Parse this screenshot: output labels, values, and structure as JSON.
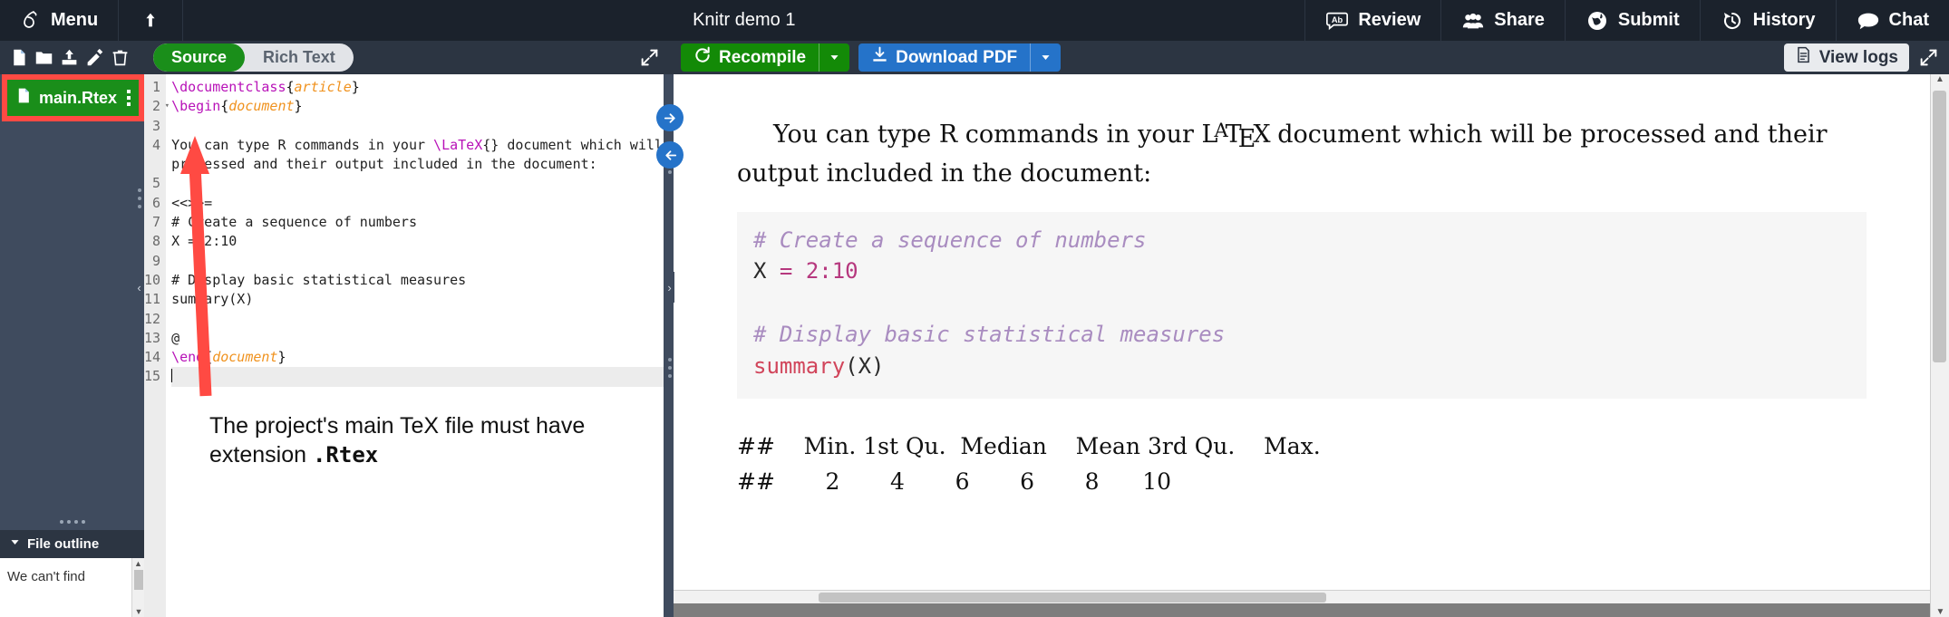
{
  "topnav": {
    "menu_label": "Menu",
    "upload_icon": "upload-arrow-icon",
    "project_title": "Knitr demo 1",
    "right_items": [
      {
        "label": "Review",
        "icon": "review-ab-icon"
      },
      {
        "label": "Share",
        "icon": "people-icon"
      },
      {
        "label": "Submit",
        "icon": "globe-icon"
      },
      {
        "label": "History",
        "icon": "history-clock-icon"
      },
      {
        "label": "Chat",
        "icon": "chat-bubble-icon"
      }
    ]
  },
  "file_panel": {
    "toolbar_icons": [
      "new-file-icon",
      "new-folder-icon",
      "upload-icon",
      "rename-pencil-icon",
      "delete-trash-icon"
    ],
    "files": [
      {
        "name": "main.Rtex",
        "icon": "tex-file-icon",
        "menu_icon": "kebab-menu-icon",
        "selected": true,
        "highlight_color": "#1a8e1a",
        "annotation_border_color": "#ff4a43"
      }
    ],
    "outline_title": "File outline",
    "outline_chevron": "chevron-down-icon",
    "outline_body_text": "We can't find"
  },
  "editor": {
    "tabs": [
      {
        "label": "Source",
        "active": true
      },
      {
        "label": "Rich Text",
        "active": false
      }
    ],
    "expand_icon": "expand-diagonal-icon",
    "lines": [
      {
        "no": "1",
        "fold": false,
        "segments": [
          {
            "t": "\\documentclass",
            "c": "cmd"
          },
          {
            "t": "{",
            "c": "brace"
          },
          {
            "t": "article",
            "c": "arg2"
          },
          {
            "t": "}",
            "c": "brace"
          }
        ]
      },
      {
        "no": "2",
        "fold": true,
        "segments": [
          {
            "t": "\\begin",
            "c": "cmd"
          },
          {
            "t": "{",
            "c": "brace"
          },
          {
            "t": "document",
            "c": "arg"
          },
          {
            "t": "}",
            "c": "brace"
          }
        ]
      },
      {
        "no": "3",
        "fold": false,
        "segments": []
      },
      {
        "no": "4",
        "fold": false,
        "segments": [
          {
            "t": "You can type R commands in your ",
            "c": "plain"
          },
          {
            "t": "\\LaTeX",
            "c": "cmd"
          },
          {
            "t": "{} document which will be",
            "c": "plain"
          }
        ]
      },
      {
        "no": "",
        "fold": false,
        "segments": [
          {
            "t": "processed and their output included in the document:",
            "c": "plain"
          }
        ]
      },
      {
        "no": "5",
        "fold": false,
        "segments": []
      },
      {
        "no": "6",
        "fold": false,
        "segments": [
          {
            "t": "<<>>=",
            "c": "plain"
          }
        ]
      },
      {
        "no": "7",
        "fold": false,
        "segments": [
          {
            "t": "# Create a sequence of numbers",
            "c": "plain"
          }
        ]
      },
      {
        "no": "8",
        "fold": false,
        "segments": [
          {
            "t": "X = 2:10",
            "c": "plain"
          }
        ]
      },
      {
        "no": "9",
        "fold": false,
        "segments": []
      },
      {
        "no": "10",
        "fold": false,
        "segments": [
          {
            "t": "# Display basic statistical measures",
            "c": "plain"
          }
        ]
      },
      {
        "no": "11",
        "fold": false,
        "segments": [
          {
            "t": "summary(X)",
            "c": "plain"
          }
        ]
      },
      {
        "no": "12",
        "fold": false,
        "segments": []
      },
      {
        "no": "13",
        "fold": false,
        "segments": [
          {
            "t": "@",
            "c": "plain"
          }
        ]
      },
      {
        "no": "14",
        "fold": false,
        "segments": [
          {
            "t": "\\end",
            "c": "cmd"
          },
          {
            "t": "{",
            "c": "brace"
          },
          {
            "t": "document",
            "c": "arg"
          },
          {
            "t": "}",
            "c": "brace"
          }
        ]
      },
      {
        "no": "15",
        "fold": false,
        "cursor": true,
        "segments": []
      }
    ],
    "annotation": {
      "text_line1": "The project's main TeX file must have",
      "text_line2_prefix": "extension ",
      "text_line2_mono": ".Rtex",
      "arrow_color": "#ff4a43"
    }
  },
  "pdf": {
    "recompile_label": "Recompile",
    "recompile_icon": "refresh-icon",
    "recompile_caret": "chevron-down-icon",
    "recompile_color": "#138a07",
    "download_label": "Download PDF",
    "download_icon": "download-icon",
    "download_caret": "chevron-down-icon",
    "download_color": "#2573c9",
    "viewlogs_label": "View logs",
    "viewlogs_icon": "logs-file-icon",
    "expand_icon": "expand-diagonal-icon",
    "sync_to_pdf_icon": "arrow-right-circle-icon",
    "sync_to_code_icon": "arrow-left-circle-icon",
    "paragraph": "You can type R commands in your LATEX document which will be processed and their output included in the document:",
    "paragraph_plain": "You can type R commands in your ",
    "paragraph_latex": "LaTeX",
    "paragraph_rest": " document which will be processed and their output included in the document:",
    "code_lines": [
      {
        "tokens": [
          {
            "t": "# Create a sequence of numbers",
            "c": "comment"
          }
        ]
      },
      {
        "tokens": [
          {
            "t": "X ",
            "c": "ident"
          },
          {
            "t": "= ",
            "c": "op"
          },
          {
            "t": "2:10",
            "c": "num"
          }
        ]
      },
      {
        "tokens": [
          {
            "t": "",
            "c": "ident"
          }
        ]
      },
      {
        "tokens": [
          {
            "t": "# Display basic statistical measures",
            "c": "comment"
          }
        ]
      },
      {
        "tokens": [
          {
            "t": "summary",
            "c": "fn"
          },
          {
            "t": "(X)",
            "c": "ident"
          }
        ]
      }
    ],
    "output_header": "##    Min. 1st Qu.  Median    Mean 3rd Qu.    Max.",
    "output_values": "##       2       4       6       6       8      10"
  }
}
